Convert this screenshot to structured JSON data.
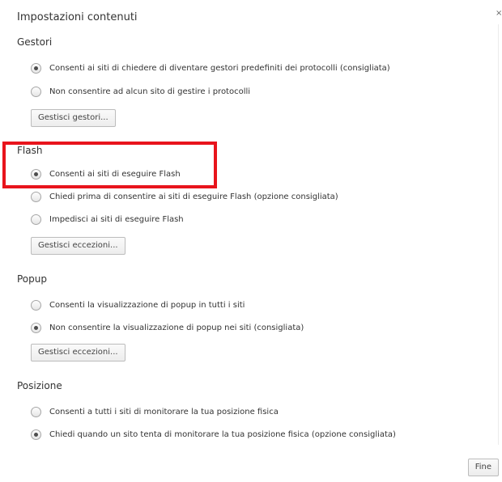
{
  "dialog": {
    "title": "Impostazioni contenuti",
    "close_icon": "close-icon"
  },
  "sections": {
    "gestori": {
      "title": "Gestori",
      "options": [
        {
          "label": "Consenti ai siti di chiedere di diventare gestori predefiniti dei protocolli (consigliata)",
          "checked": true
        },
        {
          "label": "Non consentire ad alcun sito di gestire i protocolli",
          "checked": false
        }
      ],
      "button": "Gestisci gestori..."
    },
    "flash": {
      "title": "Flash",
      "options": [
        {
          "label": "Consenti ai siti di eseguire Flash",
          "checked": true
        },
        {
          "label": "Chiedi prima di consentire ai siti di eseguire Flash (opzione consigliata)",
          "checked": false
        },
        {
          "label": "Impedisci ai siti di eseguire Flash",
          "checked": false
        }
      ],
      "button": "Gestisci eccezioni..."
    },
    "popup": {
      "title": "Popup",
      "options": [
        {
          "label": "Consenti la visualizzazione di popup in tutti i siti",
          "checked": false
        },
        {
          "label": "Non consentire la visualizzazione di popup nei siti (consigliata)",
          "checked": true
        }
      ],
      "button": "Gestisci eccezioni..."
    },
    "posizione": {
      "title": "Posizione",
      "options": [
        {
          "label": "Consenti a tutti i siti di monitorare la tua posizione fisica",
          "checked": false
        },
        {
          "label": "Chiedi quando un sito tenta di monitorare la tua posizione fisica (opzione consigliata)",
          "checked": true
        }
      ]
    }
  },
  "footer": {
    "done_label": "Fine"
  },
  "colors": {
    "highlight": "#e8141c"
  }
}
